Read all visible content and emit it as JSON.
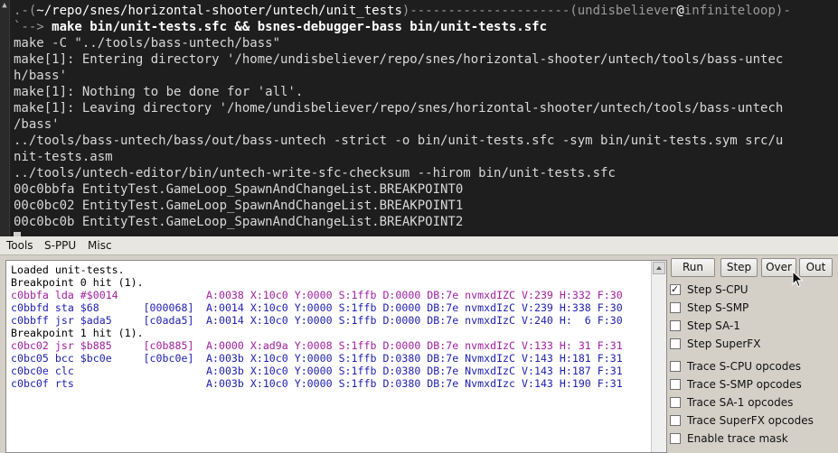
{
  "terminal": {
    "prompt_line": {
      "dot": ".",
      "open": "-(",
      "path": "~/repo/snes/horizontal-shooter/untech/unit_tests",
      "close": ")",
      "dashes": "--------------------",
      "open2": "-(",
      "user": "undisbeliever",
      "at": "@",
      "host": "infiniteloop",
      "close2": ")-"
    },
    "command_line": {
      "arrow": "`-->",
      "command": " make bin/unit-tests.sfc && bsnes-debugger-bass bin/unit-tests.sfc"
    },
    "output_lines": [
      "make -C \"../tools/bass-untech/bass\"",
      "make[1]: Entering directory '/home/undisbeliever/repo/snes/horizontal-shooter/untech/tools/bass-untec",
      "h/bass'",
      "make[1]: Nothing to be done for 'all'.",
      "make[1]: Leaving directory '/home/undisbeliever/repo/snes/horizontal-shooter/untech/tools/bass-untech",
      "/bass'",
      "../tools/bass-untech/bass/out/bass-untech -strict -o bin/unit-tests.sfc -sym bin/unit-tests.sym src/u",
      "nit-tests.asm",
      "../tools/untech-editor/bin/untech-write-sfc-checksum --hirom bin/unit-tests.sfc",
      "00c0bbfa EntityTest.GameLoop_SpawnAndChangeList.BREAKPOINT0",
      "00c0bc02 EntityTest.GameLoop_SpawnAndChangeList.BREAKPOINT1",
      "00c0bc0b EntityTest.GameLoop_SpawnAndChangeList.BREAKPOINT2"
    ]
  },
  "menubar": {
    "items": [
      "Tools",
      "S-PPU",
      "Misc"
    ]
  },
  "console": {
    "lines": [
      {
        "color": "k",
        "text": "Loaded unit-tests."
      },
      {
        "color": "k",
        "text": "Breakpoint 0 hit (1)."
      },
      {
        "color": "m",
        "text": "c0bbfa lda #$0014",
        "regs": "A:0038 X:10c0 Y:0000 S:1ffb D:0000 DB:7e nvmxdIZC V:239 H:332 F:30"
      },
      {
        "color": "b",
        "text": "c0bbfd sta $68       [000068]",
        "regs": "A:0014 X:10c0 Y:0000 S:1ffb D:0000 DB:7e nvmxdIzC V:239 H:338 F:30"
      },
      {
        "color": "b",
        "text": "c0bbff jsr $ada5     [c0ada5]",
        "regs": "A:0014 X:10c0 Y:0000 S:1ffb D:0000 DB:7e nvmxdIzC V:240 H:  6 F:30"
      },
      {
        "color": "k",
        "text": "Breakpoint 1 hit (1)."
      },
      {
        "color": "m",
        "text": "c0bc02 jsr $b885     [c0b885]",
        "regs": "A:0000 X:ad9a Y:0008 S:1ffb D:0000 DB:7e nvmxdIzC V:133 H: 31 F:31"
      },
      {
        "color": "b",
        "text": "c0bc05 bcc $bc0e     [c0bc0e]",
        "regs": "A:003b X:10c0 Y:0000 S:1ffb D:0380 DB:7e NvmxdIzC V:143 H:181 F:31"
      },
      {
        "color": "b",
        "text": "c0bc0e clc",
        "regs": "A:003b X:10c0 Y:0000 S:1ffb D:0380 DB:7e NvmxdIzC V:143 H:187 F:31"
      },
      {
        "color": "b",
        "text": "c0bc0f rts",
        "regs": "A:003b X:10c0 Y:0000 S:1ffb D:0380 DB:7e NvmxdIzc V:143 H:190 F:31"
      }
    ]
  },
  "controls": {
    "buttons": {
      "run": "Run",
      "step": "Step",
      "over": "Over",
      "out": "Out"
    },
    "options": [
      {
        "label": "Step S-CPU",
        "checked": true
      },
      {
        "label": "Step S-SMP",
        "checked": false
      },
      {
        "label": "Step SA-1",
        "checked": false
      },
      {
        "label": "Step SuperFX",
        "checked": false
      },
      {
        "label": "Trace S-CPU opcodes",
        "checked": false
      },
      {
        "label": "Trace S-SMP opcodes",
        "checked": false
      },
      {
        "label": "Trace SA-1 opcodes",
        "checked": false
      },
      {
        "label": "Trace SuperFX opcodes",
        "checked": false
      },
      {
        "label": "Enable trace mask",
        "checked": false
      }
    ]
  }
}
